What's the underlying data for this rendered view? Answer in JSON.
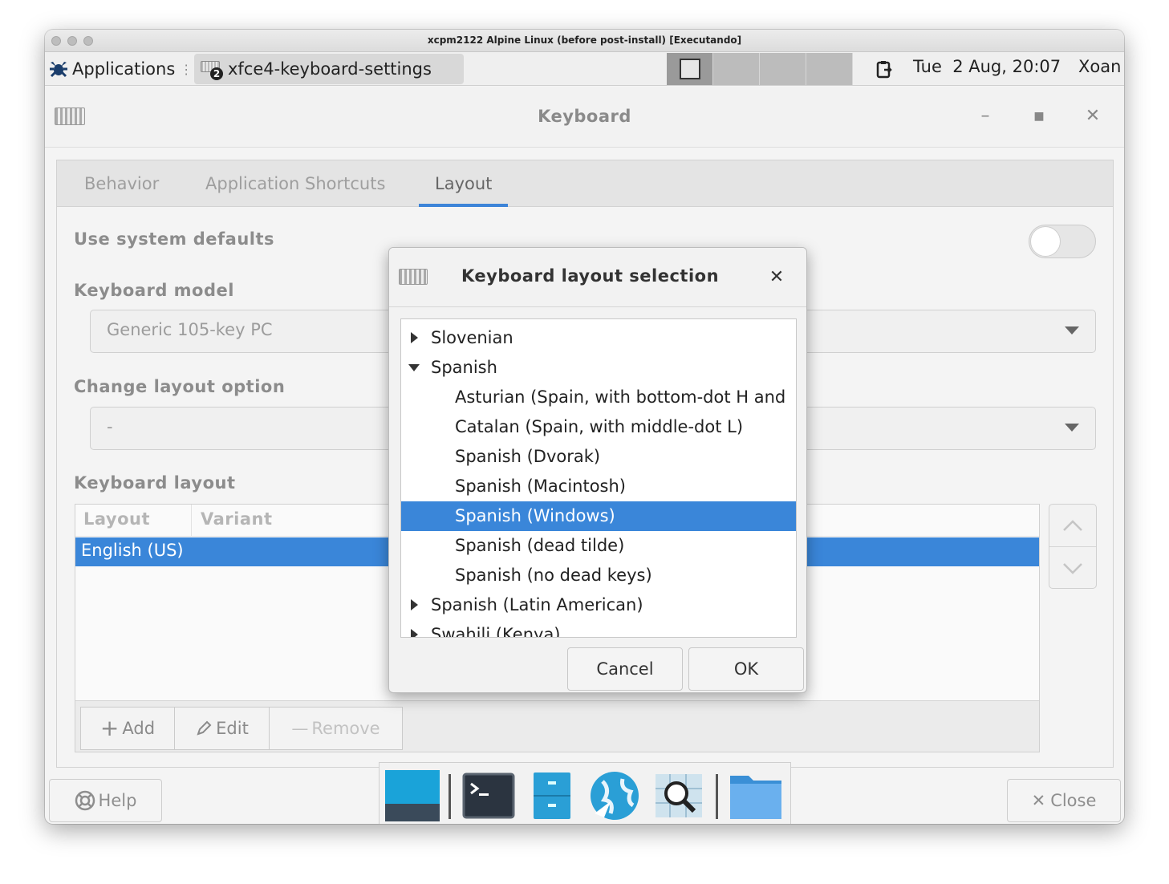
{
  "mac": {
    "title": "xcpm2122 Alpine Linux (before post-install) [Executando]"
  },
  "panel": {
    "applications_label": "Applications",
    "task_label": "xfce4-keyboard-settings",
    "task_count": "2",
    "clock": "Tue  2 Aug, 20:07",
    "user": "Xoan"
  },
  "app": {
    "title": "Keyboard",
    "tabs": [
      "Behavior",
      "Application Shortcuts",
      "Layout"
    ],
    "active_tab": "Layout",
    "use_system_defaults_label": "Use system defaults",
    "keyboard_model_label": "Keyboard model",
    "keyboard_model_value": "Generic 105-key PC",
    "change_layout_option_label": "Change layout option",
    "change_layout_option_value": "-",
    "keyboard_layout_label": "Keyboard layout",
    "columns": [
      "Layout",
      "Variant"
    ],
    "layouts": [
      {
        "layout": "English (US)",
        "variant": ""
      }
    ],
    "add_label": "Add",
    "edit_label": "Edit",
    "remove_label": "Remove",
    "help_label": "Help",
    "close_label": "Close"
  },
  "dialog": {
    "title": "Keyboard layout selection",
    "items": [
      {
        "label": "Slovenian",
        "level": 0,
        "expander": "collapsed",
        "selected": false
      },
      {
        "label": "Spanish",
        "level": 0,
        "expander": "expanded",
        "selected": false
      },
      {
        "label": "Asturian (Spain, with bottom-dot H and",
        "level": 1,
        "expander": "none",
        "selected": false
      },
      {
        "label": "Catalan (Spain, with middle-dot L)",
        "level": 1,
        "expander": "none",
        "selected": false
      },
      {
        "label": "Spanish (Dvorak)",
        "level": 1,
        "expander": "none",
        "selected": false
      },
      {
        "label": "Spanish (Macintosh)",
        "level": 1,
        "expander": "none",
        "selected": false
      },
      {
        "label": "Spanish (Windows)",
        "level": 1,
        "expander": "none",
        "selected": true
      },
      {
        "label": "Spanish (dead tilde)",
        "level": 1,
        "expander": "none",
        "selected": false
      },
      {
        "label": "Spanish (no dead keys)",
        "level": 1,
        "expander": "none",
        "selected": false
      },
      {
        "label": "Spanish (Latin American)",
        "level": 0,
        "expander": "collapsed",
        "selected": false
      },
      {
        "label": "Swahili (Kenya)",
        "level": 0,
        "expander": "collapsed",
        "selected": false
      }
    ],
    "cancel_label": "Cancel",
    "ok_label": "OK"
  },
  "dock": {
    "items": [
      "desktop-icon",
      "terminal-icon",
      "file-cabinet-icon",
      "web-browser-icon",
      "app-finder-icon",
      "folder-icon"
    ]
  },
  "colors": {
    "accent": "#3a86d9",
    "tab_underline": "#3d84d8"
  }
}
